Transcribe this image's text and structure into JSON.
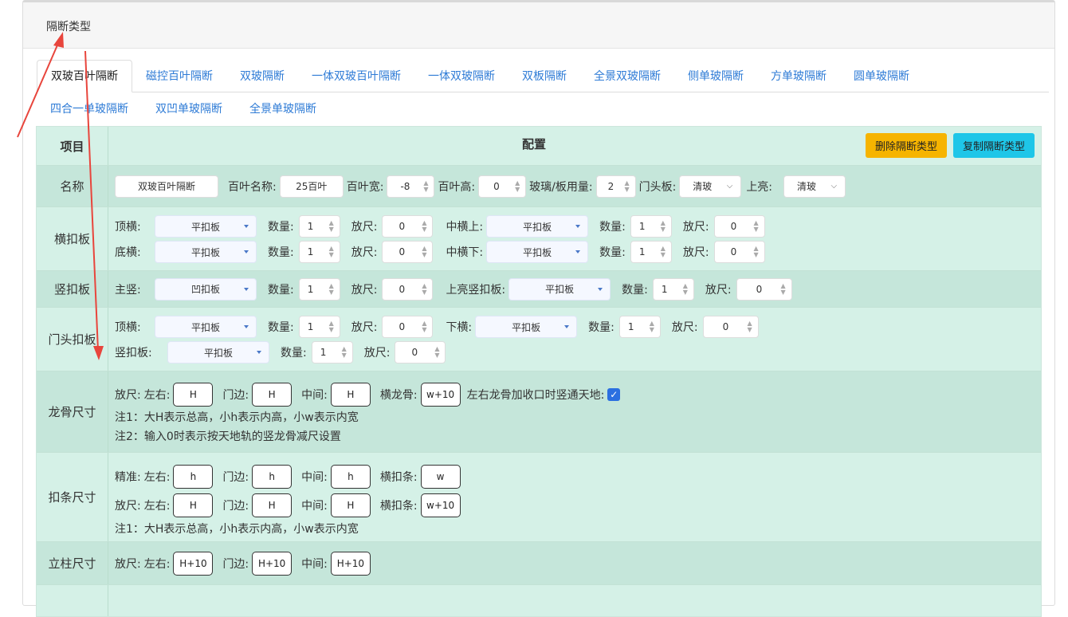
{
  "panel_title": "隔断类型",
  "tabs": [
    "双玻百叶隔断",
    "磁控百叶隔断",
    "双玻隔断",
    "一体双玻百叶隔断",
    "一体双玻隔断",
    "双板隔断",
    "全景双玻隔断",
    "侧单玻隔断",
    "方单玻隔断",
    "圆单玻隔断"
  ],
  "tabs2": [
    "四合一单玻隔断",
    "双凹单玻隔断",
    "全景单玻隔断"
  ],
  "header": {
    "col_item": "项目",
    "col_config": "配置",
    "delete_btn": "删除隔断类型",
    "copy_btn": "复制隔断类型"
  },
  "name_row": {
    "label": "名称",
    "name_value": "双玻百叶隔断",
    "blind_name_label": "百叶名称:",
    "blind_name_value": "25百叶",
    "blind_width_label": "百叶宽:",
    "blind_width_value": "-8",
    "blind_height_label": "百叶高:",
    "blind_height_value": "0",
    "glass_label": "玻璃/板用量:",
    "glass_value": "2",
    "door_head_label": "门头板:",
    "door_head_value": "清玻",
    "top_light_label": "上亮:",
    "top_light_value": "清玻"
  },
  "hbar": {
    "label": "横扣板",
    "top_label": "顶横:",
    "top_value": "平扣板",
    "top_qty": "1",
    "top_allow": "0",
    "midtop_label": "中横上:",
    "midtop_value": "平扣板",
    "midtop_qty": "1",
    "midtop_allow": "0",
    "bottom_label": "底横:",
    "bottom_value": "平扣板",
    "bottom_qty": "1",
    "bottom_allow": "0",
    "midbot_label": "中横下:",
    "midbot_value": "平扣板",
    "midbot_qty": "1",
    "midbot_allow": "0"
  },
  "vbar": {
    "label": "竖扣板",
    "main_label": "主竖:",
    "main_value": "凹扣板",
    "main_qty": "1",
    "main_allow": "0",
    "toplight_label": "上亮竖扣板:",
    "toplight_value": "平扣板",
    "toplight_qty": "1",
    "toplight_allow": "0"
  },
  "doorhead": {
    "label": "门头扣板",
    "top_label": "顶横:",
    "top_value": "平扣板",
    "top_qty": "1",
    "top_allow": "0",
    "low_label": "下横:",
    "low_value": "平扣板",
    "low_qty": "1",
    "low_allow": "0",
    "vert_label": "竖扣板:",
    "vert_value": "平扣板",
    "vert_qty": "1",
    "vert_allow": "0"
  },
  "common": {
    "qty_label": "数量:",
    "allow_label": "放尺:"
  },
  "keel": {
    "label": "龙骨尺寸",
    "allow_label": "放尺:",
    "lr_label": "左右:",
    "lr_value": "H",
    "door_label": "门边:",
    "door_value": "H",
    "mid_label": "中间:",
    "mid_value": "H",
    "hkeel_label": "横龙骨:",
    "hkeel_value": "w+10",
    "through_label": "左右龙骨加收口时竖通天地:",
    "note1": "注1：大H表示总高，小h表示内高，小w表示内宽",
    "note2": "注2：输入0时表示按天地轨的竖龙骨减尺设置"
  },
  "strip": {
    "label": "扣条尺寸",
    "exact_label": "精准:",
    "lr_label": "左右:",
    "door_label": "门边:",
    "mid_label": "中间:",
    "h_label": "横扣条:",
    "exact_lr": "h",
    "exact_door": "h",
    "exact_mid": "h",
    "exact_h": "w",
    "allow_label": "放尺:",
    "allow_lr": "H",
    "allow_door": "H",
    "allow_mid": "H",
    "allow_h": "w+10",
    "note1": "注1：大H表示总高，小h表示内高，小w表示内宽"
  },
  "post": {
    "label": "立柱尺寸",
    "allow_label": "放尺:",
    "lr_label": "左右:",
    "lr_value": "H+10",
    "door_label": "门边:",
    "door_value": "H+10",
    "mid_label": "中间:",
    "mid_value": "H+10"
  },
  "colors": {
    "accent": "#2e7bd6",
    "row_light": "#d5f1e7",
    "row_dark": "#c5e6da",
    "delete": "#f6b400",
    "copy": "#1ec6e8",
    "arrow": "#e8453c"
  }
}
